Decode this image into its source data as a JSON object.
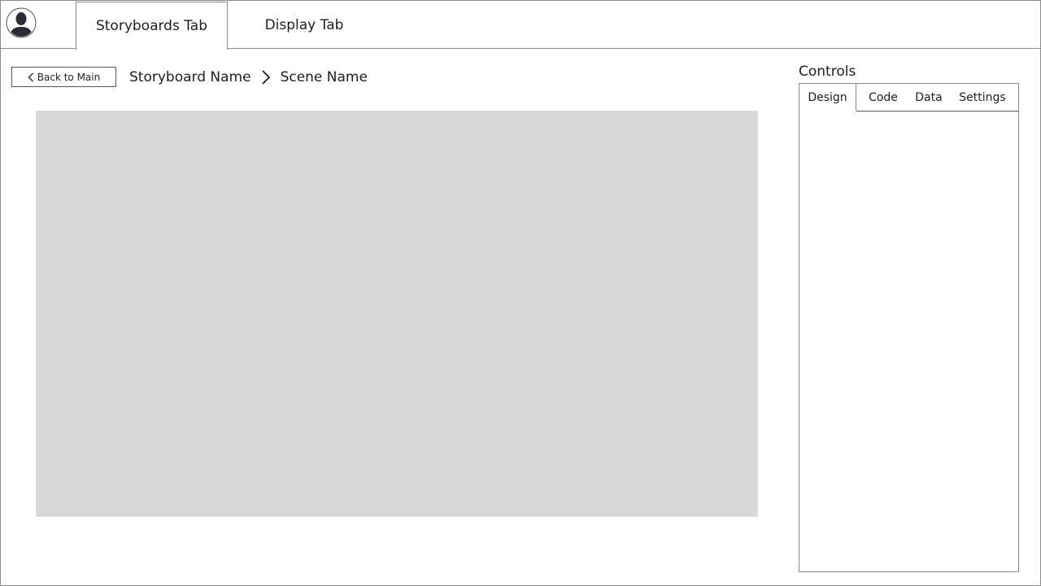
{
  "header": {
    "avatar_icon": "user-avatar-icon",
    "tabs": [
      {
        "label": "Storyboards Tab",
        "active": true
      },
      {
        "label": "Display Tab",
        "active": false
      }
    ]
  },
  "navigation": {
    "back_label": "Back to Main",
    "back_icon": "chevron-left-icon",
    "breadcrumb": {
      "storyboard": "Storyboard Name",
      "separator_icon": "chevron-right-icon",
      "scene": "Scene Name"
    }
  },
  "canvas": {
    "color": "#d9d9d9"
  },
  "controls": {
    "title": "Controls",
    "tabs": [
      {
        "label": "Design",
        "active": true
      },
      {
        "label": "Code",
        "active": false
      },
      {
        "label": "Data",
        "active": false
      },
      {
        "label": "Settings",
        "active": false
      }
    ]
  }
}
